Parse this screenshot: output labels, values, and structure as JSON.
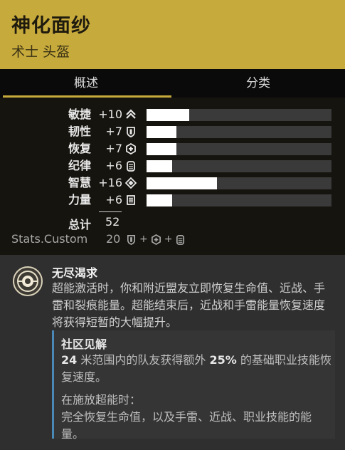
{
  "header": {
    "item_name": "神化面纱",
    "item_type": "术士 头盔"
  },
  "tabs": [
    {
      "label": "概述",
      "active": true
    },
    {
      "label": "分类",
      "active": false
    }
  ],
  "stats": [
    {
      "name": "敏捷",
      "value": "+10",
      "icon": "mobility-icon",
      "fill_pct": 23
    },
    {
      "name": "韧性",
      "value": "+7",
      "icon": "resilience-icon",
      "fill_pct": 16
    },
    {
      "name": "恢复",
      "value": "+7",
      "icon": "recovery-icon",
      "fill_pct": 16
    },
    {
      "name": "纪律",
      "value": "+6",
      "icon": "discipline-icon",
      "fill_pct": 14
    },
    {
      "name": "智慧",
      "value": "+16",
      "icon": "intellect-icon",
      "fill_pct": 38
    },
    {
      "name": "力量",
      "value": "+6",
      "icon": "strength-icon",
      "fill_pct": 14
    }
  ],
  "total": {
    "label": "总计",
    "value": "52"
  },
  "custom": {
    "label": "Stats.Custom",
    "value": "20",
    "icons": [
      "resilience-icon",
      "recovery-icon",
      "discipline-icon"
    ],
    "sep": "+"
  },
  "perk": {
    "name": "无尽渴求",
    "icon": "perk-emblem-icon",
    "description": "超能激活时，你和附近盟友立即恢复生命值、近战、手雷和裂痕能量。超能结束后，近战和手雷能量恢复速度将获得短暂的大幅提升。"
  },
  "insights": {
    "title": "社区见解",
    "line1_a": "24",
    "line1_b": " 米范围内的队友获得额外 ",
    "line1_c": "25%",
    "line1_d": " 的基础职业技能恢复速度。",
    "line2": "在施放超能时：",
    "line3": "完全恢复生命值，以及手雷、近战、职业技能的能量。"
  },
  "colors": {
    "accent": "#c7aa3c",
    "insight_border": "#4a88b8",
    "bar_fill": "#ffffff",
    "bar_bg": "#3a3a3a"
  }
}
